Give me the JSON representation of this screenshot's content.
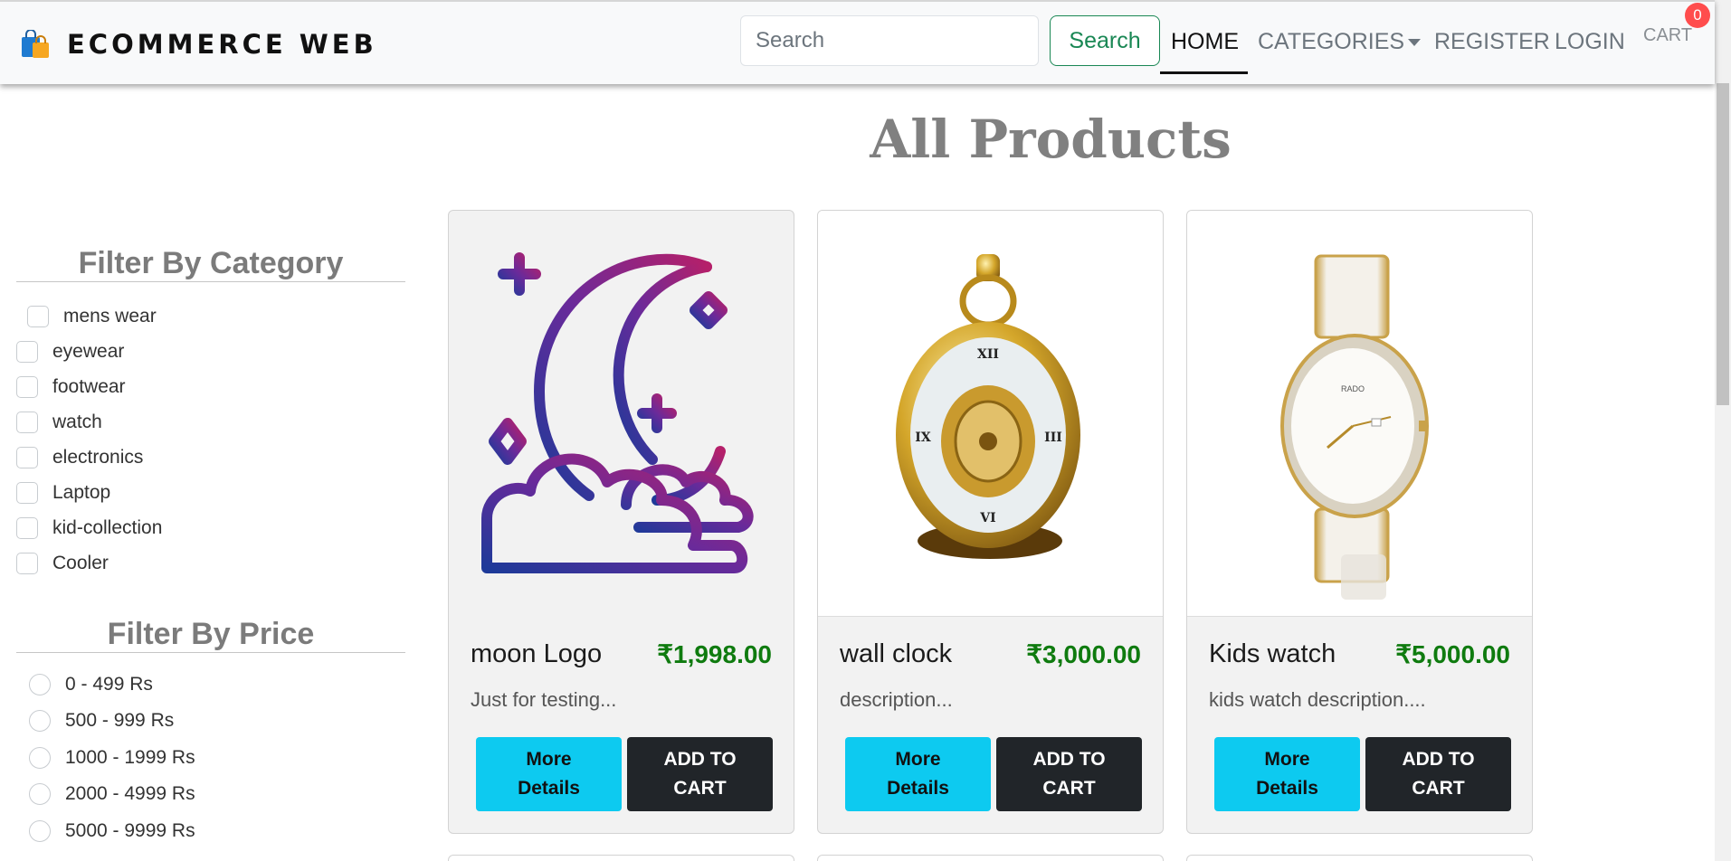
{
  "nav": {
    "brand": "ECOMMERCE WEB",
    "brand_icon": "shopping-bags-icon",
    "search_placeholder": "Search",
    "search_button": "Search",
    "links": {
      "home": "HOME",
      "categories": "CATEGORIES",
      "register": "REGISTER",
      "login": "LOGIN",
      "cart": "CART"
    },
    "cart_count": "0"
  },
  "page_title": "All Products",
  "filters": {
    "category_title": "Filter By Category",
    "categories": [
      "mens wear",
      "eyewear",
      "footwear",
      "watch",
      "electronics",
      "Laptop",
      "kid-collection",
      "Cooler"
    ],
    "price_title": "Filter By Price",
    "prices": [
      "0 - 499 Rs",
      "500 - 999 Rs",
      "1000 - 1999 Rs",
      "2000 - 4999 Rs",
      "5000 - 9999 Rs"
    ]
  },
  "products": [
    {
      "name": "moon Logo",
      "price": "₹1,998.00",
      "description": "Just for testing...",
      "image": "moon-logo-image",
      "details_button": "More Details",
      "cart_button": "ADD TO CART"
    },
    {
      "name": "wall clock",
      "price": "₹3,000.00",
      "description": "description...",
      "image": "pocket-watch-image",
      "details_button": "More Details",
      "cart_button": "ADD TO CART"
    },
    {
      "name": "Kids watch",
      "price": "₹5,000.00",
      "description": "kids watch description....",
      "image": "wrist-watch-image",
      "details_button": "More Details",
      "cart_button": "ADD TO CART"
    }
  ],
  "colors": {
    "price": "#0f7b0f",
    "details_button": "#0dcaf0",
    "cart_button": "#212529",
    "search_button": "#198754",
    "cart_badge": "#ff4d4d"
  }
}
